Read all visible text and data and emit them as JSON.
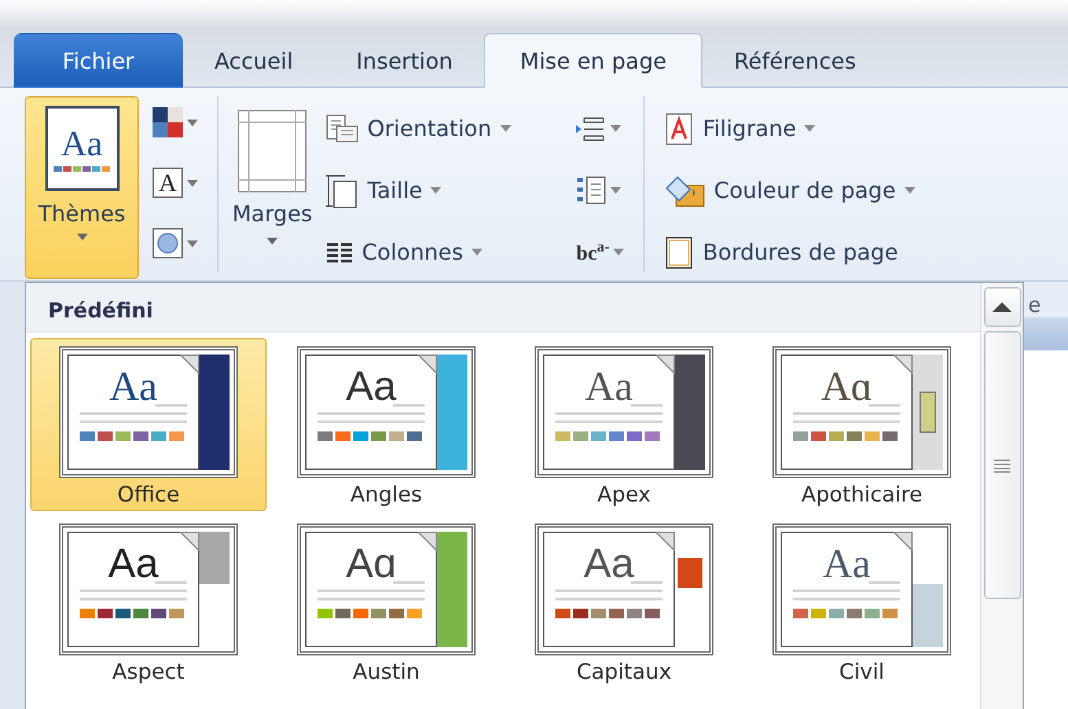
{
  "tabs": [
    {
      "label": "Fichier",
      "kind": "file",
      "selected": false
    },
    {
      "label": "Accueil",
      "kind": "tab",
      "selected": false
    },
    {
      "label": "Insertion",
      "kind": "tab",
      "selected": false
    },
    {
      "label": "Mise en page",
      "kind": "tab",
      "selected": true
    },
    {
      "label": "Références",
      "kind": "tab",
      "selected": false
    }
  ],
  "ribbon": {
    "themes": {
      "label": "Thèmes",
      "sample": "Aa",
      "pressed": true
    },
    "theme_fonts_letter": "A",
    "margins": "Marges",
    "page_setup": [
      {
        "label": "Orientation",
        "dropdown": true
      },
      {
        "label": "Taille",
        "dropdown": true
      },
      {
        "label": "Colonnes",
        "dropdown": true
      }
    ],
    "hyphenation": {
      "base": "bc",
      "raised": "a-"
    },
    "background": [
      {
        "label": "Filigrane",
        "dropdown": true
      },
      {
        "label": "Couleur de page",
        "dropdown": true
      },
      {
        "label": "Bordures de page",
        "dropdown": false
      }
    ],
    "group_label_fragment": "e"
  },
  "gallery": {
    "header": "Prédéfini",
    "themes": [
      {
        "name": "Office",
        "selected": true,
        "sample": {
          "text": "Aa",
          "kind": "serif",
          "color": "#1f497d"
        },
        "accent": {
          "kind": "full",
          "color": "#1f2f6e"
        },
        "swatches": [
          {
            "color": "#4f81bd"
          },
          {
            "color": "#c0504d"
          },
          {
            "color": "#9bbb59"
          },
          {
            "color": "#8064a2"
          },
          {
            "color": "#4bacc6"
          },
          {
            "color": "#f79646"
          }
        ]
      },
      {
        "name": "Angles",
        "selected": false,
        "sample": {
          "text": "Aa",
          "kind": "sans",
          "color": "#333333"
        },
        "accent": {
          "kind": "full",
          "color": "#3cb2dc"
        },
        "swatches": [
          {
            "color": "#797b7e"
          },
          {
            "color": "#f96a1b"
          },
          {
            "color": "#08a1d9"
          },
          {
            "color": "#7c984a"
          },
          {
            "color": "#c2ad8d"
          },
          {
            "color": "#506e94"
          }
        ]
      },
      {
        "name": "Apex",
        "selected": false,
        "sample": {
          "text": "Aa",
          "kind": "serif",
          "color": "#555555"
        },
        "accent": {
          "kind": "full",
          "color": "#4a4a52"
        },
        "swatches": [
          {
            "color": "#ceb966"
          },
          {
            "color": "#9cb084"
          },
          {
            "color": "#6bb1c9"
          },
          {
            "color": "#6585cf"
          },
          {
            "color": "#7e6bc9"
          },
          {
            "color": "#a379bb"
          }
        ]
      },
      {
        "name": "Apothicaire",
        "selected": false,
        "sample": {
          "text": "Aɑ",
          "kind": "serif",
          "color": "#5a5040"
        },
        "accent": {
          "kind": "inset",
          "color": "#cfcf88"
        },
        "swatches": [
          {
            "color": "#93a299"
          },
          {
            "color": "#cf543f"
          },
          {
            "color": "#b5ae53"
          },
          {
            "color": "#848058"
          },
          {
            "color": "#e8b54d"
          },
          {
            "color": "#786c71"
          }
        ]
      },
      {
        "name": "Aspect",
        "selected": false,
        "sample": {
          "text": "Aa",
          "kind": "sans",
          "color": "#222222"
        },
        "accent": {
          "kind": "upper",
          "color": "#a8a8a8"
        },
        "swatches": [
          {
            "color": "#f07f09"
          },
          {
            "color": "#9f2936"
          },
          {
            "color": "#1b587c"
          },
          {
            "color": "#4e8542"
          },
          {
            "color": "#604878"
          },
          {
            "color": "#c19859"
          }
        ]
      },
      {
        "name": "Austin",
        "selected": false,
        "sample": {
          "text": "Aɑ",
          "kind": "sans",
          "color": "#444444"
        },
        "accent": {
          "kind": "full",
          "color": "#7ab648"
        },
        "swatches": [
          {
            "color": "#94c600"
          },
          {
            "color": "#71685a"
          },
          {
            "color": "#ff6700"
          },
          {
            "color": "#909465"
          },
          {
            "color": "#956b43"
          },
          {
            "color": "#fea022"
          }
        ]
      },
      {
        "name": "Capitaux",
        "selected": false,
        "sample": {
          "text": "Aa",
          "kind": "sans",
          "color": "#555555"
        },
        "accent": {
          "kind": "block",
          "color": "#d34817"
        },
        "swatches": [
          {
            "color": "#d34817"
          },
          {
            "color": "#9b2d1f"
          },
          {
            "color": "#a28e6a"
          },
          {
            "color": "#956251"
          },
          {
            "color": "#918485"
          },
          {
            "color": "#855d5d"
          }
        ]
      },
      {
        "name": "Civil",
        "selected": false,
        "sample": {
          "text": "Aa",
          "kind": "serif",
          "color": "#4a5a6a"
        },
        "accent": {
          "kind": "lower",
          "color": "#c4d3dc"
        },
        "swatches": [
          {
            "color": "#d16349"
          },
          {
            "color": "#ccb400"
          },
          {
            "color": "#8cadae"
          },
          {
            "color": "#8c7b70"
          },
          {
            "color": "#8fb08c"
          },
          {
            "color": "#d19049"
          }
        ]
      }
    ]
  }
}
